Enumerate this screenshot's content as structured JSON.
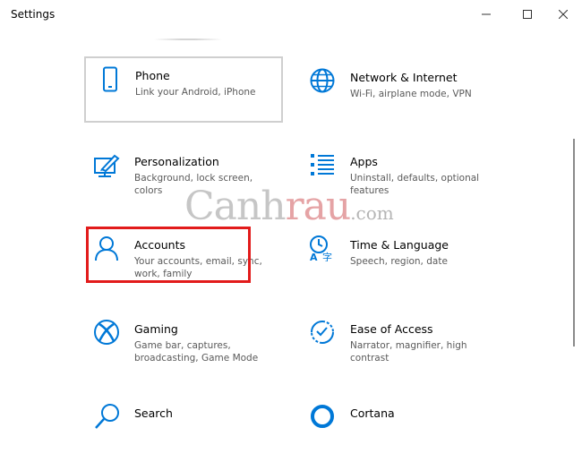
{
  "window": {
    "title": "Settings"
  },
  "tiles": {
    "phone": {
      "name": "Phone",
      "desc": "Link your Android, iPhone"
    },
    "network": {
      "name": "Network & Internet",
      "desc": "Wi-Fi, airplane mode, VPN"
    },
    "personalization": {
      "name": "Personalization",
      "desc": "Background, lock screen, colors"
    },
    "apps": {
      "name": "Apps",
      "desc": "Uninstall, defaults, optional features"
    },
    "accounts": {
      "name": "Accounts",
      "desc": "Your accounts, email, sync, work, family"
    },
    "time": {
      "name": "Time & Language",
      "desc": "Speech, region, date"
    },
    "gaming": {
      "name": "Gaming",
      "desc": "Game bar, captures, broadcasting, Game Mode"
    },
    "ease": {
      "name": "Ease of Access",
      "desc": "Narrator, magnifier, high contrast"
    },
    "search": {
      "name": "Search",
      "desc": ""
    },
    "cortana": {
      "name": "Cortana",
      "desc": ""
    }
  },
  "watermark": {
    "part1": "Canh",
    "part2": "rau",
    "part3": ".com"
  },
  "colors": {
    "accent": "#0078d7",
    "highlight": "#e21b1b"
  },
  "icons": {
    "phone": "phone-icon",
    "network": "globe-icon",
    "personalization": "paint-icon",
    "apps": "apps-list-icon",
    "accounts": "person-icon",
    "time": "language-time-icon",
    "gaming": "xbox-icon",
    "ease": "ease-of-access-icon",
    "search": "search-icon",
    "cortana": "cortana-icon"
  }
}
